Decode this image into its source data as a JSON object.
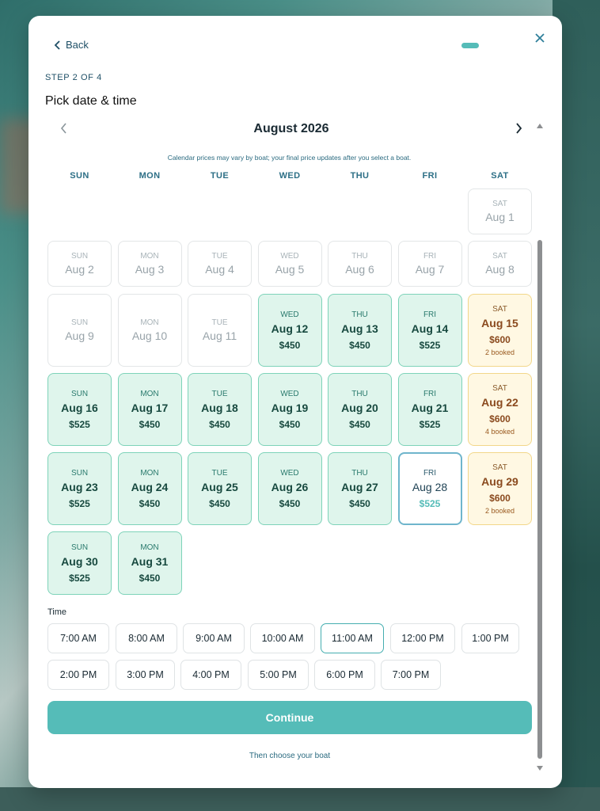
{
  "header": {
    "back_label": "Back",
    "step_label": "STEP 2 OF 4",
    "title": "Pick date & time"
  },
  "calendar": {
    "month_label": "August 2026",
    "price_note": "Calendar prices may vary by boat; your final price updates after you select a boat.",
    "weekdays": [
      "SUN",
      "MON",
      "TUE",
      "WED",
      "THU",
      "FRI",
      "SAT"
    ],
    "days": [
      {
        "dow": "SAT",
        "date": "Aug 1",
        "state": "past",
        "price": "",
        "booked": ""
      },
      {
        "dow": "SUN",
        "date": "Aug 2",
        "state": "past",
        "price": "",
        "booked": ""
      },
      {
        "dow": "MON",
        "date": "Aug 3",
        "state": "past",
        "price": "",
        "booked": ""
      },
      {
        "dow": "TUE",
        "date": "Aug 4",
        "state": "past",
        "price": "",
        "booked": ""
      },
      {
        "dow": "WED",
        "date": "Aug 5",
        "state": "past",
        "price": "",
        "booked": ""
      },
      {
        "dow": "THU",
        "date": "Aug 6",
        "state": "past",
        "price": "",
        "booked": ""
      },
      {
        "dow": "FRI",
        "date": "Aug 7",
        "state": "past",
        "price": "",
        "booked": ""
      },
      {
        "dow": "SAT",
        "date": "Aug 8",
        "state": "past",
        "price": "",
        "booked": ""
      },
      {
        "dow": "SUN",
        "date": "Aug 9",
        "state": "past",
        "price": "",
        "booked": ""
      },
      {
        "dow": "MON",
        "date": "Aug 10",
        "state": "past",
        "price": "",
        "booked": ""
      },
      {
        "dow": "TUE",
        "date": "Aug 11",
        "state": "past",
        "price": "",
        "booked": ""
      },
      {
        "dow": "WED",
        "date": "Aug 12",
        "state": "open",
        "price": "$450",
        "booked": ""
      },
      {
        "dow": "THU",
        "date": "Aug 13",
        "state": "open",
        "price": "$450",
        "booked": ""
      },
      {
        "dow": "FRI",
        "date": "Aug 14",
        "state": "open",
        "price": "$525",
        "booked": ""
      },
      {
        "dow": "SAT",
        "date": "Aug 15",
        "state": "busy",
        "price": "$600",
        "booked": "2 booked"
      },
      {
        "dow": "SUN",
        "date": "Aug 16",
        "state": "open",
        "price": "$525",
        "booked": ""
      },
      {
        "dow": "MON",
        "date": "Aug 17",
        "state": "open",
        "price": "$450",
        "booked": ""
      },
      {
        "dow": "TUE",
        "date": "Aug 18",
        "state": "open",
        "price": "$450",
        "booked": ""
      },
      {
        "dow": "WED",
        "date": "Aug 19",
        "state": "open",
        "price": "$450",
        "booked": ""
      },
      {
        "dow": "THU",
        "date": "Aug 20",
        "state": "open",
        "price": "$450",
        "booked": ""
      },
      {
        "dow": "FRI",
        "date": "Aug 21",
        "state": "open",
        "price": "$525",
        "booked": ""
      },
      {
        "dow": "SAT",
        "date": "Aug 22",
        "state": "busy",
        "price": "$600",
        "booked": "4 booked"
      },
      {
        "dow": "SUN",
        "date": "Aug 23",
        "state": "open",
        "price": "$525",
        "booked": ""
      },
      {
        "dow": "MON",
        "date": "Aug 24",
        "state": "open",
        "price": "$450",
        "booked": ""
      },
      {
        "dow": "TUE",
        "date": "Aug 25",
        "state": "open",
        "price": "$450",
        "booked": ""
      },
      {
        "dow": "WED",
        "date": "Aug 26",
        "state": "open",
        "price": "$450",
        "booked": ""
      },
      {
        "dow": "THU",
        "date": "Aug 27",
        "state": "open",
        "price": "$450",
        "booked": ""
      },
      {
        "dow": "FRI",
        "date": "Aug 28",
        "state": "selected",
        "price": "$525",
        "booked": ""
      },
      {
        "dow": "SAT",
        "date": "Aug 29",
        "state": "busy",
        "price": "$600",
        "booked": "2 booked"
      },
      {
        "dow": "SUN",
        "date": "Aug 30",
        "state": "open",
        "price": "$525",
        "booked": ""
      },
      {
        "dow": "MON",
        "date": "Aug 31",
        "state": "open",
        "price": "$450",
        "booked": ""
      }
    ]
  },
  "time": {
    "label": "Time",
    "options": [
      "7:00 AM",
      "8:00 AM",
      "9:00 AM",
      "10:00 AM",
      "11:00 AM",
      "12:00 PM",
      "1:00 PM",
      "2:00 PM",
      "3:00 PM",
      "4:00 PM",
      "5:00 PM",
      "6:00 PM",
      "7:00 PM"
    ],
    "selected": "11:00 AM"
  },
  "footer": {
    "continue_label": "Continue",
    "subnote": "Then choose your boat"
  },
  "colors": {
    "accent": "#55bcb8",
    "available_bg": "#dff5ec",
    "busy_bg": "#fff8e3",
    "text_dark": "#1e4f66"
  }
}
